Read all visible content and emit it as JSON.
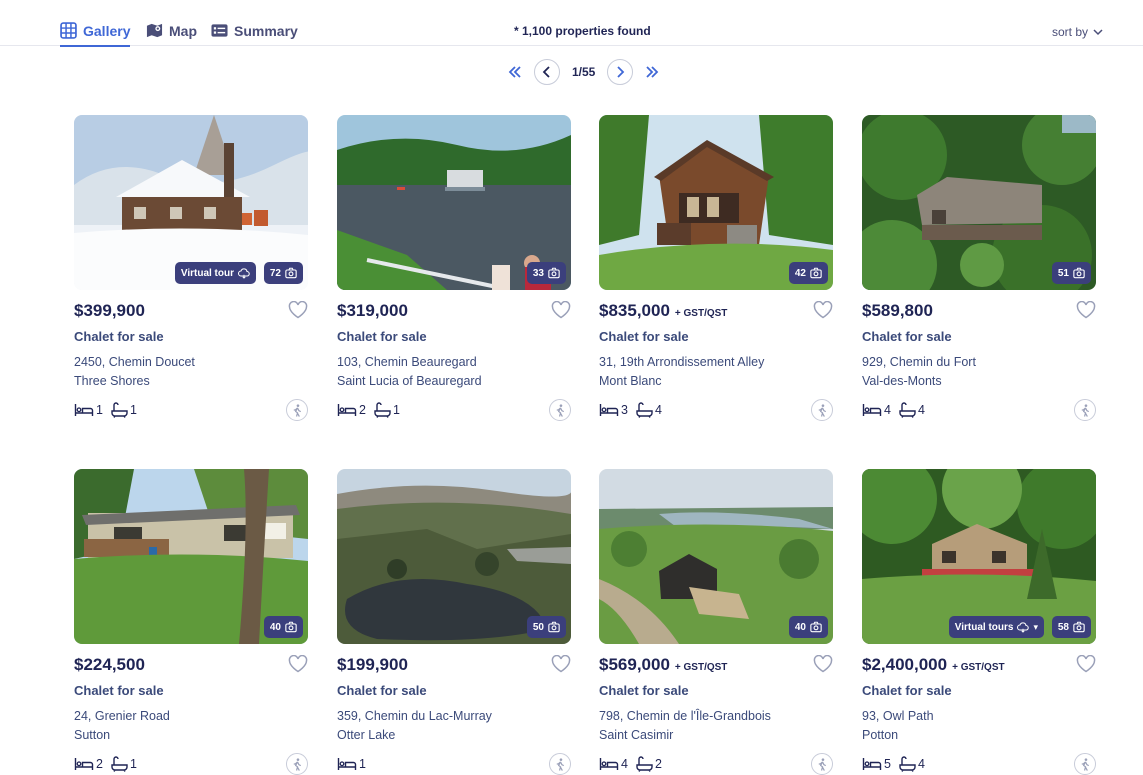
{
  "tabs": [
    {
      "label": "Gallery",
      "icon": "grid-icon",
      "active": true
    },
    {
      "label": "Map",
      "icon": "map-icon",
      "active": false
    },
    {
      "label": "Summary",
      "icon": "list-icon",
      "active": false
    }
  ],
  "results": {
    "text": "* 1,100 properties found"
  },
  "sort": {
    "label": "sort by"
  },
  "pagination": {
    "label": "1/55"
  },
  "listings": [
    {
      "price": "$399,900",
      "tax": "",
      "type": "Chalet for sale",
      "address1": "2450, Chemin Doucet",
      "address2": "Three Shores",
      "beds": "1",
      "baths": "1",
      "photos": "72",
      "tour": "Virtual tour",
      "scene": "winter"
    },
    {
      "price": "$319,000",
      "tax": "",
      "type": "Chalet for sale",
      "address1": "103, Chemin Beauregard",
      "address2": "Saint Lucia of Beauregard",
      "beds": "2",
      "baths": "1",
      "photos": "33",
      "tour": "",
      "scene": "lake"
    },
    {
      "price": "$835,000",
      "tax": "+ GST/QST",
      "type": "Chalet for sale",
      "address1": "31, 19th Arrondissement Alley",
      "address2": "Mont Blanc",
      "beds": "3",
      "baths": "4",
      "photos": "42",
      "tour": "",
      "scene": "chalet"
    },
    {
      "price": "$589,800",
      "tax": "",
      "type": "Chalet for sale",
      "address1": "929, Chemin du Fort",
      "address2": "Val-des-Monts",
      "beds": "4",
      "baths": "4",
      "photos": "51",
      "tour": "",
      "scene": "forest"
    },
    {
      "price": "$224,500",
      "tax": "",
      "type": "Chalet for sale",
      "address1": "24, Grenier Road",
      "address2": "Sutton",
      "beds": "2",
      "baths": "1",
      "photos": "40",
      "tour": "",
      "scene": "bungalow"
    },
    {
      "price": "$199,900",
      "tax": "",
      "type": "Chalet for sale",
      "address1": "359, Chemin du Lac-Murray",
      "address2": "Otter Lake",
      "beds": "1",
      "baths": "",
      "photos": "50",
      "tour": "",
      "scene": "aerial"
    },
    {
      "price": "$569,000",
      "tax": "+ GST/QST",
      "type": "Chalet for sale",
      "address1": "798, Chemin de l'Île-Grandbois",
      "address2": "Saint Casimir",
      "beds": "4",
      "baths": "2",
      "photos": "40",
      "tour": "",
      "scene": "river"
    },
    {
      "price": "$2,400,000",
      "tax": "+ GST/QST",
      "type": "Chalet for sale",
      "address1": "93, Owl Path",
      "address2": "Potton",
      "beds": "5",
      "baths": "4",
      "photos": "58",
      "tour": "Virtual tours",
      "scene": "estate"
    }
  ],
  "colors": {
    "accent": "#3f67d6",
    "text": "#1f2454",
    "badge": "#3b3f7c"
  }
}
